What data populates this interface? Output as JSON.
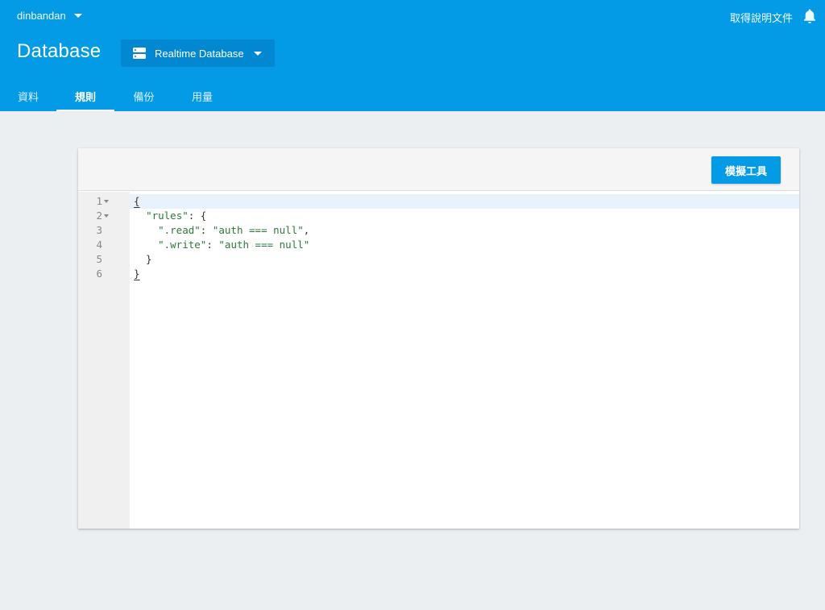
{
  "header": {
    "project_name": "dinbandan",
    "help_link": "取得說明文件",
    "page_title": "Database",
    "db_selector": "Realtime Database",
    "tabs": [
      {
        "label": "資料",
        "active": false
      },
      {
        "label": "規則",
        "active": true
      },
      {
        "label": "備份",
        "active": false
      },
      {
        "label": "用量",
        "active": false
      }
    ],
    "icons": {
      "bell": "bell-icon",
      "database": "database-icon",
      "caret": "chevron-down-icon"
    }
  },
  "editor": {
    "toolbar_button": "模擬工具",
    "lines": [
      {
        "num": "1",
        "open": "{",
        "key": "",
        "sep": "",
        "value": "",
        "tail": ""
      },
      {
        "num": "2",
        "open": "  ",
        "key": "\"rules\"",
        "sep": ": {",
        "value": "",
        "tail": ""
      },
      {
        "num": "3",
        "open": "    ",
        "key": "\".read\"",
        "sep": ": ",
        "value": "\"auth === null\"",
        "tail": ","
      },
      {
        "num": "4",
        "open": "    ",
        "key": "\".write\"",
        "sep": ": ",
        "value": "\"auth === null\"",
        "tail": ""
      },
      {
        "num": "5",
        "open": "  }",
        "key": "",
        "sep": "",
        "value": "",
        "tail": ""
      },
      {
        "num": "6",
        "open": "}",
        "key": "",
        "sep": "",
        "value": "",
        "tail": ""
      }
    ]
  },
  "colors": {
    "header_bg": "#039be5",
    "selector_bg": "#0288d1",
    "page_bg": "#eceff1",
    "string_green": "#2b7a3b"
  }
}
